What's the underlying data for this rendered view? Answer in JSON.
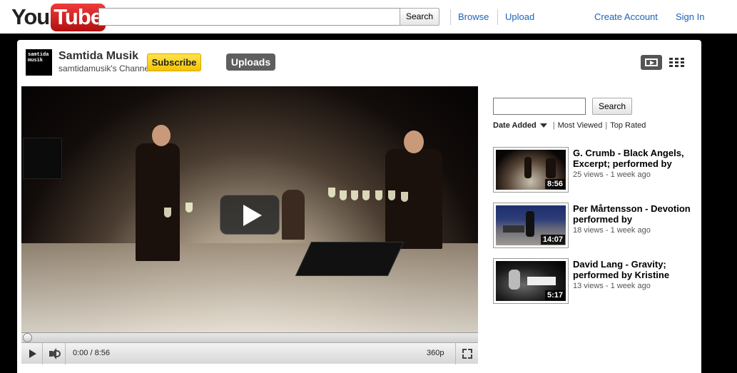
{
  "masthead": {
    "logo_you": "You",
    "logo_tube": "Tube",
    "search_placeholder": "",
    "search_button": "Search",
    "nav": {
      "browse": "Browse",
      "upload": "Upload",
      "create_account": "Create Account",
      "sign_in": "Sign In"
    }
  },
  "channel": {
    "thumb_text": "samtida musik",
    "name": "Samtida Musik",
    "subtitle": "samtidamusik's Channel",
    "subscribe_label": "Subscribe",
    "uploads_label": "Uploads"
  },
  "player": {
    "time": "0:00 / 8:56",
    "quality": "360p",
    "progress": 0
  },
  "sidebar": {
    "search_placeholder": "",
    "search_button": "Search",
    "sort": {
      "active": "Date Added",
      "options": [
        "Most Viewed",
        "Top Rated"
      ]
    },
    "videos": [
      {
        "title": "G. Crumb - Black Angels, Excerpt; performed by",
        "meta": "25 views - 1 week ago",
        "duration": "8:56"
      },
      {
        "title": "Per Mårtensson - Devotion performed by",
        "meta": "18 views - 1 week ago",
        "duration": "14:07"
      },
      {
        "title": "David Lang - Gravity; performed by Kristine",
        "meta": "13 views - 1 week ago",
        "duration": "5:17"
      }
    ]
  },
  "colors": {
    "link": "#1c62b9",
    "subscribe": "#f5c400",
    "logo_red": "#cc181e"
  }
}
